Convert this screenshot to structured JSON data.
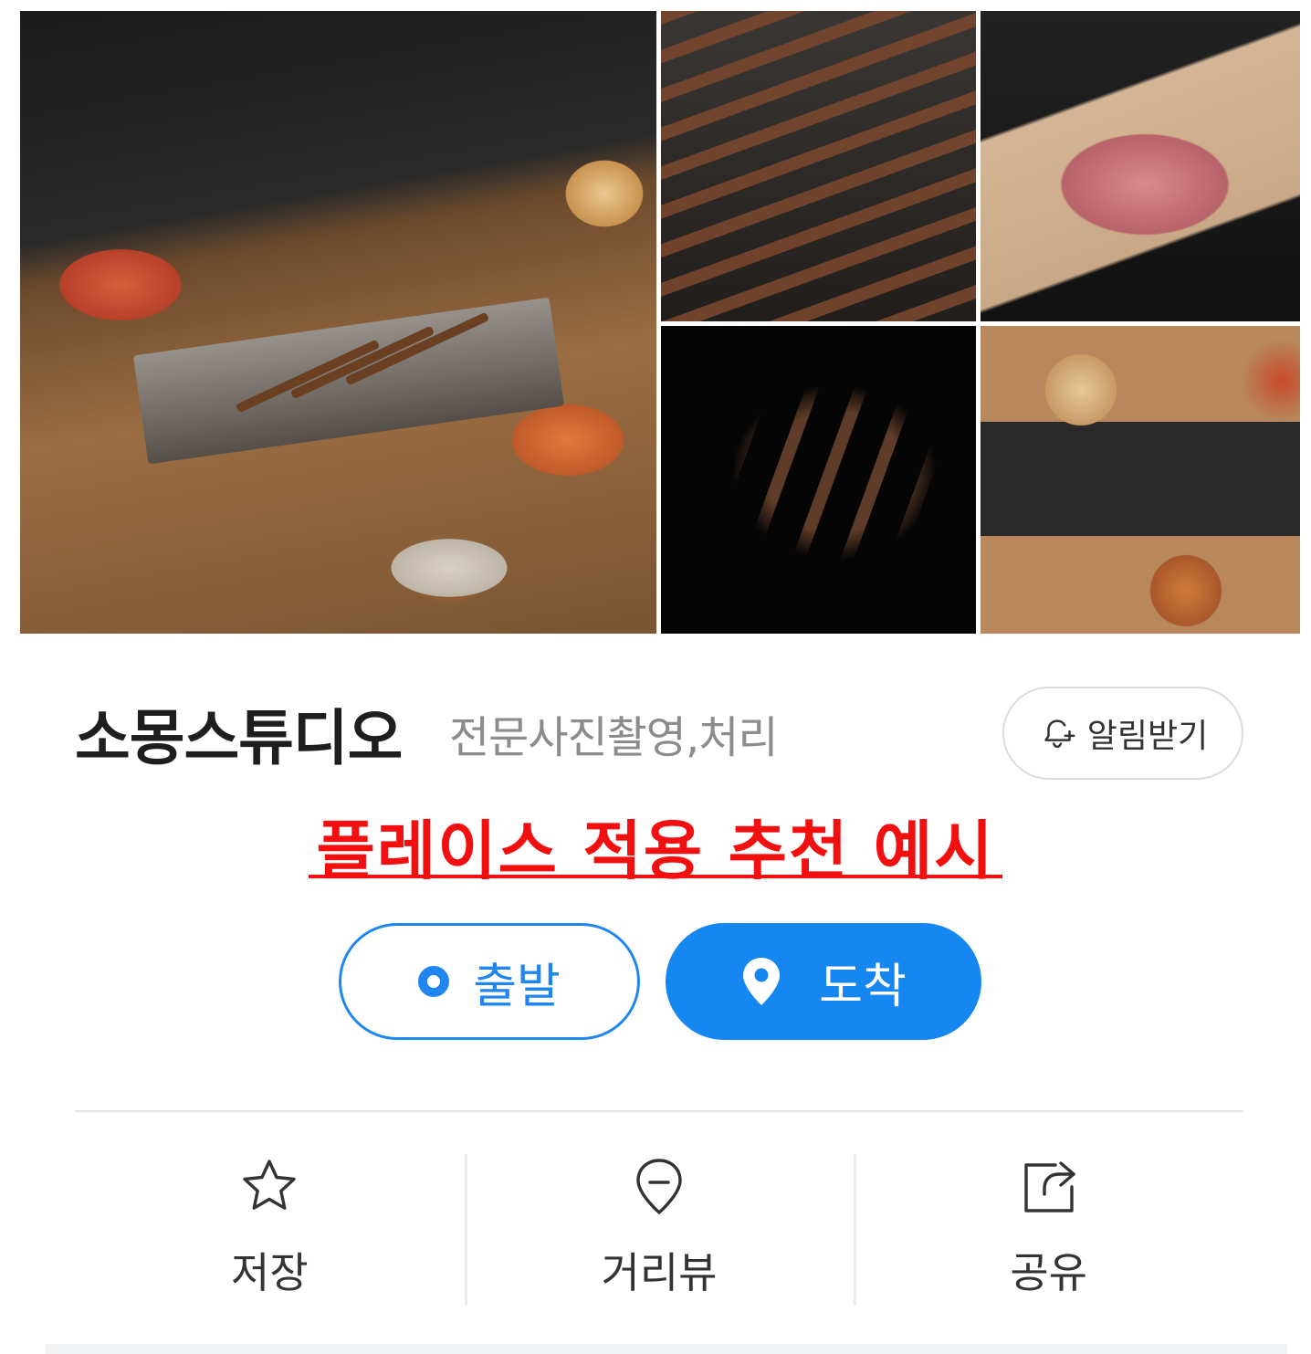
{
  "place": {
    "name": "소몽스튜디오",
    "category": "전문사진촬영,처리",
    "notify_label": "알림받기"
  },
  "banner": {
    "text": "플레이스 적용 추천 예시"
  },
  "route": {
    "start_label": "출발",
    "end_label": "도착"
  },
  "actions": {
    "save_label": "저장",
    "streetview_label": "거리뷰",
    "share_label": "공유"
  },
  "colors": {
    "accent_blue": "#1687f1",
    "banner_red": "#f20f0f",
    "category_gray": "#8c8c8c"
  },
  "icons": [
    "bell-plus-icon",
    "circle-dot-icon",
    "location-pin-icon",
    "star-icon",
    "map-pin-outline-icon",
    "share-icon"
  ]
}
